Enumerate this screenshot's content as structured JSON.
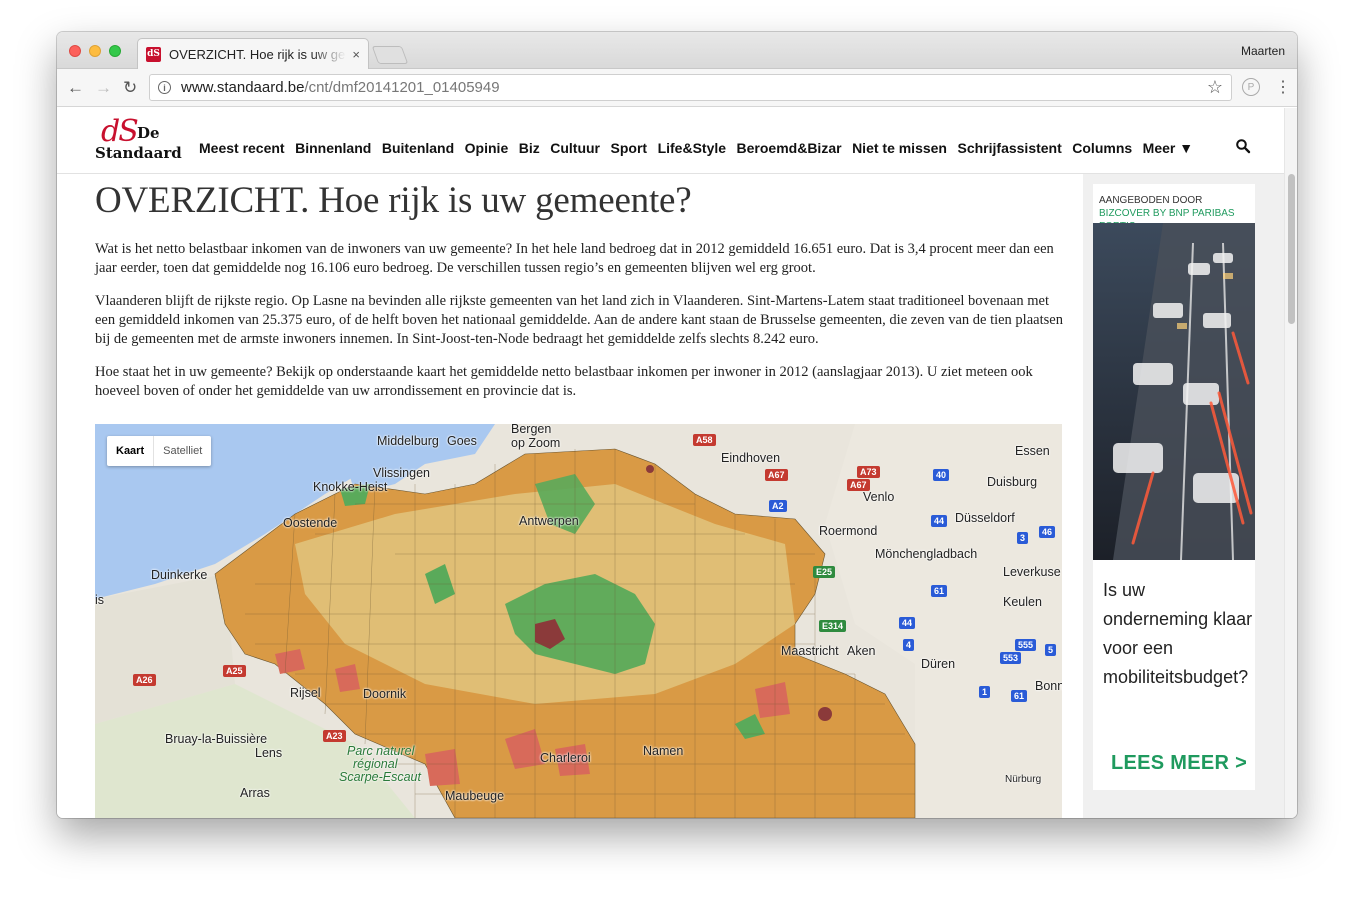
{
  "browser": {
    "tab_title": "OVERZICHT. Hoe rijk is uw gemeente? | De Standaard",
    "tab_close": "×",
    "favicon_text": "dS",
    "profile_name": "Maarten",
    "url_host": "www.standaard.be",
    "url_path": "/cnt/dmf20141201_01405949",
    "back": "←",
    "forward": "→",
    "reload": "↻",
    "info": "i",
    "bookmark": "☆",
    "extension": "P",
    "menu": "⋮"
  },
  "site": {
    "logo_ds": "dS",
    "logo_de": "De",
    "logo_standaard": "Standaard",
    "nav": [
      "Meest recent",
      "Binnenland",
      "Buitenland",
      "Opinie",
      "Biz",
      "Cultuur",
      "Sport",
      "Life&Style",
      "Beroemd&Bizar",
      "Niet te missen",
      "Schrijfassistent",
      "Columns",
      "Meer ▼"
    ]
  },
  "article": {
    "headline": "OVERZICHT. Hoe rijk is uw gemeente?",
    "paragraphs": [
      "Wat is het netto belastbaar inkomen van de inwoners van uw gemeente? In het hele land bedroeg dat in 2012 gemiddeld 16.651 euro. Dat is 3,4 procent meer dan een jaar eerder, toen dat gemiddelde nog 16.106 euro bedroeg. De verschillen tussen regio’s en gemeenten blijven wel erg groot.",
      "Vlaanderen blijft de rijkste regio. Op Lasne na bevinden alle rijkste gemeenten van het land zich in Vlaanderen. Sint-Martens-Latem staat traditioneel bovenaan met een gemiddeld inkomen van 25.375 euro, of de helft boven het nationaal gemiddelde. Aan de andere kant staan de Brusselse gemeenten, die zeven van de tien plaatsen bij de gemeenten met de armste inwoners innemen. In Sint-Joost-ten-Node bedraagt het gemiddelde zelfs slechts 8.242 euro.",
      "Hoe staat het in uw gemeente? Bekijk op onderstaande kaart het gemiddelde netto belastbaar inkomen per inwoner in 2012 (aanslagjaar 2013). U ziet meteen ook hoeveel boven of onder het gemiddelde van uw arrondissement en provincie dat is."
    ]
  },
  "map": {
    "toggle_map": "Kaart",
    "toggle_satellite": "Satelliet",
    "labels": [
      "Middelburg",
      "Goes",
      "Bergen",
      "op Zoom",
      "Eindhoven",
      "Essen",
      "Vlissingen",
      "Knokke-Heist",
      "Duisburg",
      "Venlo",
      "Oostende",
      "Roermond",
      "Düsseldorf",
      "Antwerpen",
      "Mönchengladbach",
      "Duinkerke",
      "Leverkuse",
      "Keulen",
      "Maastricht",
      "Aken",
      "Düren",
      "Rijsel",
      "Doornik",
      "Bonn",
      "Bruay-la-Buissière",
      "Lens",
      "Parc naturel",
      "régional",
      "Scarpe-Escaut",
      "Arras",
      "Maubeuge",
      "Namen",
      "Charleroi",
      "Nürburg",
      "is"
    ],
    "roads": [
      "A58",
      "A73",
      "A67",
      "40",
      "A67",
      "A2",
      "44",
      "3",
      "46",
      "E25",
      "61",
      "E314",
      "44",
      "4",
      "555",
      "553",
      "5",
      "A25",
      "A26",
      "A23",
      "1",
      "61"
    ],
    "colors": {
      "rich": "#5aaa5a",
      "above": "#e0c27a",
      "mid": "#d99a45",
      "low": "#d86a5a",
      "poorest": "#8b3a3a"
    }
  },
  "ad": {
    "offered_by": "AANGEBODEN DOOR ",
    "sponsor": "BIZCOVER BY BNP PARIBAS FORTIS",
    "question": "Is uw onderneming klaar voor een mobiliteitsbudget?",
    "cta": "LEES MEER >"
  }
}
